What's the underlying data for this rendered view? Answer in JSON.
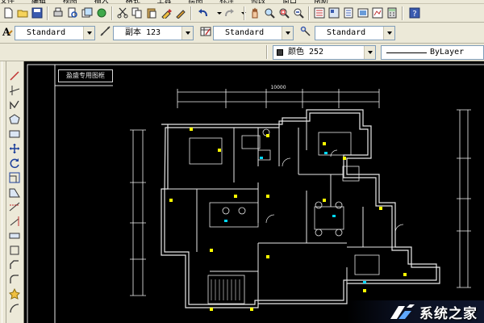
{
  "menu": {
    "items": [
      "文件",
      "编辑",
      "视图",
      "插入",
      "格式",
      "工具",
      "绘图",
      "标注",
      "修改",
      "窗口",
      "帮助"
    ]
  },
  "toolbar_styles": {
    "text_style": "Standard",
    "dim_style": "副本 123",
    "table_style": "Standard",
    "mleader_style": "Standard"
  },
  "toolbar_properties": {
    "color_label": "颜色 252",
    "linetype_label": "ByLayer"
  },
  "drawing": {
    "title_block": "盈盛专用图框",
    "dimension_top": "10000"
  },
  "watermark": {
    "text": "系统之家"
  },
  "colors": {
    "toolbar_bg": "#ece9d8",
    "canvas_bg": "#000000",
    "wall": "#e8e8e8",
    "dimension": "#f0f0f0",
    "accent_yellow": "#ffff00",
    "accent_cyan": "#00d8ff"
  },
  "icons": {
    "standard_toolbar": [
      "new-icon",
      "open-icon",
      "save-icon",
      "plot-icon",
      "print-preview-icon",
      "publish-icon",
      "cut-icon",
      "copy-icon",
      "paste-icon",
      "match-properties-icon",
      "undo-icon",
      "redo-icon",
      "pan-icon",
      "zoom-realtime-icon",
      "zoom-window-icon",
      "zoom-previous-icon",
      "properties-icon",
      "design-center-icon",
      "tool-palettes-icon",
      "sheet-set-icon",
      "markup-icon",
      "calculator-icon",
      "help-icon"
    ],
    "draw_toolbar": [
      "line-icon",
      "construction-line-icon",
      "polyline-icon",
      "polygon-icon",
      "rectangle-icon",
      "arc-icon",
      "circle-icon",
      "revision-cloud-icon",
      "spline-icon",
      "ellipse-icon",
      "block-icon",
      "hatch-icon",
      "region-icon",
      "table-icon",
      "mtext-icon"
    ]
  }
}
